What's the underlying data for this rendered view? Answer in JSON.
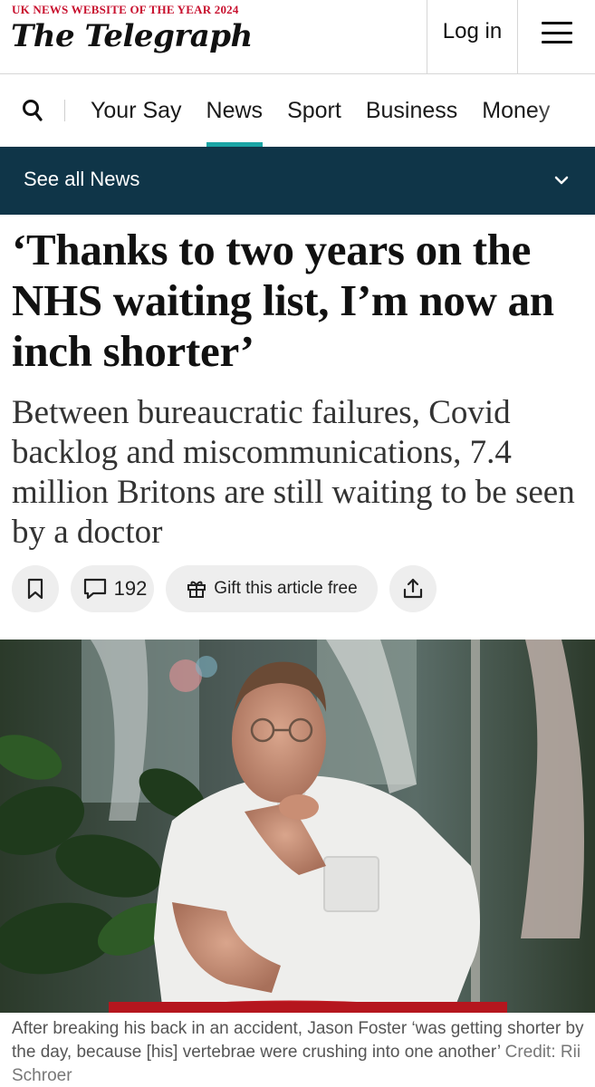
{
  "header": {
    "tagline": "UK NEWS WEBSITE OF THE YEAR 2024",
    "logo": "The Telegraph",
    "login_label": "Log in",
    "menu_icon": "hamburger-icon"
  },
  "nav": {
    "search_icon": "search-icon",
    "items": [
      {
        "label": "Your Say"
      },
      {
        "label": "News",
        "active": true
      },
      {
        "label": "Sport"
      },
      {
        "label": "Business"
      },
      {
        "label": "Money"
      }
    ],
    "accent_color": "#1aa5a5"
  },
  "section_bar": {
    "label": "See all News",
    "icon": "chevron-down-icon",
    "background": "#0f3548"
  },
  "article": {
    "headline": "‘Thanks to two years on the NHS waiting list, I’m now an inch shorter’",
    "standfirst": "Between bureaucratic failures, Covid backlog and miscommunications, 7.4 million Britons are still waiting to be seen by a doctor",
    "actions": {
      "bookmark_icon": "bookmark-icon",
      "comments_icon": "comment-icon",
      "comment_count": "192",
      "gift_icon": "gift-icon",
      "gift_label": "Gift this article free",
      "share_icon": "share-icon"
    },
    "image": {
      "caption": "After breaking his back in an accident, Jason Foster ‘was getting shorter by the day, because [his] vertebrae were crushing into one another’",
      "credit": "Credit: Rii Schroer"
    }
  }
}
